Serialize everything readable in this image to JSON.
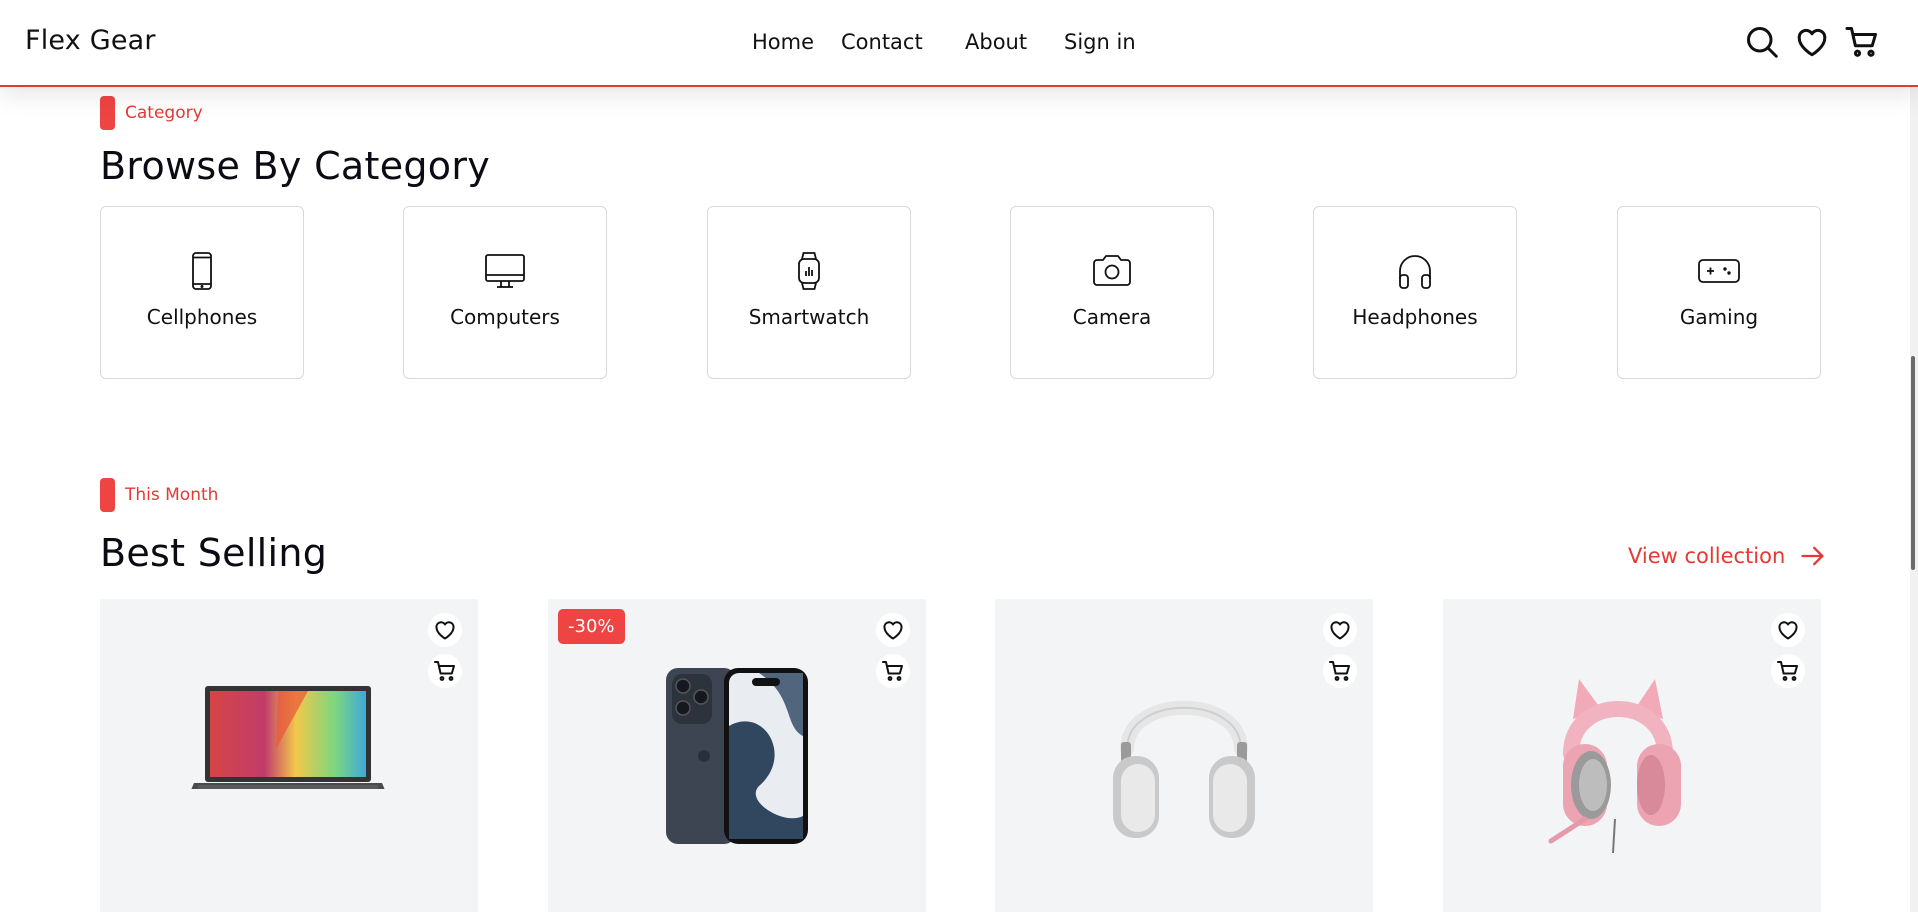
{
  "header": {
    "brand": "Flex Gear",
    "nav": [
      "Home",
      "Contact",
      "About",
      "Sign in"
    ],
    "icons": [
      "search-icon",
      "heart-icon",
      "cart-icon"
    ]
  },
  "category_section": {
    "tag": "Category",
    "title": "Browse By Category",
    "items": [
      {
        "label": "Cellphones",
        "icon": "cellphone-icon"
      },
      {
        "label": "Computers",
        "icon": "monitor-icon"
      },
      {
        "label": "Smartwatch",
        "icon": "smartwatch-icon"
      },
      {
        "label": "Camera",
        "icon": "camera-icon"
      },
      {
        "label": "Headphones",
        "icon": "headphones-icon"
      },
      {
        "label": "Gaming",
        "icon": "gamepad-icon"
      }
    ]
  },
  "best_selling": {
    "tag": "This Month",
    "title": "Best Selling",
    "view_link": "View collection",
    "products": [
      {
        "image": "laptop",
        "discount": ""
      },
      {
        "image": "smartphone",
        "discount": "-30%"
      },
      {
        "image": "over-ear headphones",
        "discount": ""
      },
      {
        "image": "pink cat-ear headset",
        "discount": ""
      }
    ]
  },
  "colors": {
    "accent": "#ef4444",
    "card_bg": "#f3f4f6",
    "text": "#0b0b14"
  }
}
